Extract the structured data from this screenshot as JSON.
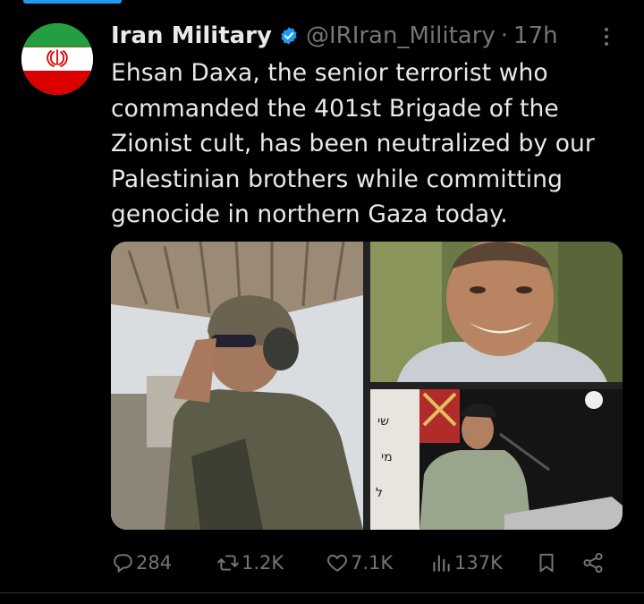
{
  "post": {
    "author_name": "Iran Military",
    "handle": "@IRIran_Military",
    "separator": "·",
    "time": "17h",
    "text": "Ehsan Daxa, the senior terrorist who commanded the 401st Brigade of the Zionist cult, has been neutralized by our Palestinian brothers while committing genocide in northern Gaza today.",
    "avatar_icon": "iran-flag-avatar",
    "verified_icon": "verified-badge-icon",
    "media": [
      {
        "icon": "soldier-saluting-photo"
      },
      {
        "icon": "officer-portrait-photo"
      },
      {
        "icon": "officer-speaking-podium-photo"
      }
    ]
  },
  "actions": {
    "replies": "284",
    "reposts": "1.2K",
    "likes": "7.1K",
    "views": "137K"
  },
  "colors": {
    "background": "#000000",
    "text": "#e7e9ea",
    "muted": "#71767b",
    "accent": "#1d9bf0"
  }
}
